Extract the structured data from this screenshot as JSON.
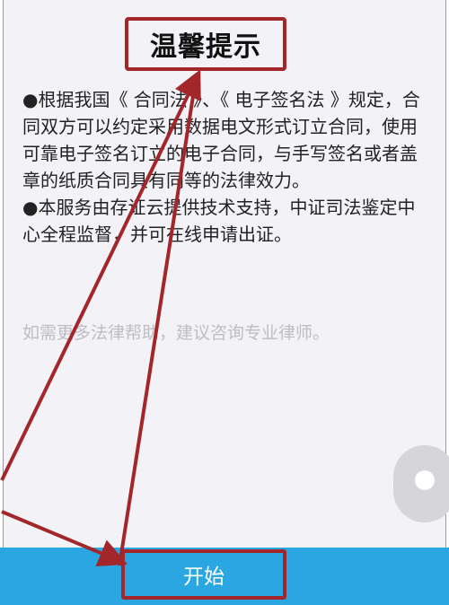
{
  "dialog": {
    "title": "温馨提示",
    "paragraph1": "●根据我国《 合同法 》、《 电子签名法 》规定，合同双方可以约定采用数据电文形式订立合同，使用可靠电子签名订立的电子合同，与手写签名或者盖章的纸质合同具有同等的法律效力。",
    "paragraph2": "●本服务由存证云提供技术支持，中证司法鉴定中心全程监督，并可在线申请出证。",
    "hint": "如需更多法律帮助，建议咨询专业律师。"
  },
  "start_button": {
    "label": "开始"
  },
  "colors": {
    "start_bar": "#2aa7e3",
    "annotation": "#a3262b",
    "background": "#f2f2f7"
  }
}
